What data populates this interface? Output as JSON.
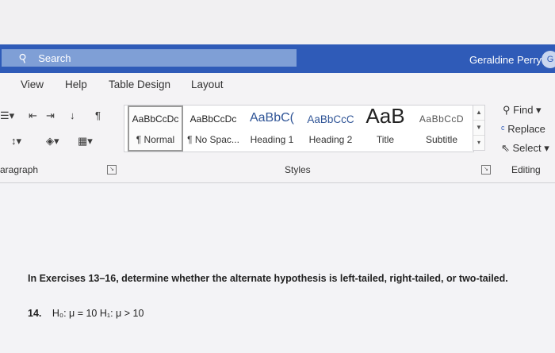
{
  "titlebar": {
    "search_label": "Search",
    "user_name": "Geraldine Perry",
    "avatar_initial": "G"
  },
  "tabs": [
    "View",
    "Help",
    "Table Design",
    "Layout"
  ],
  "styles": [
    {
      "sample": "AaBbCcDc",
      "name": "¶ Normal"
    },
    {
      "sample": "AaBbCcDc",
      "name": "¶ No Spac..."
    },
    {
      "sample": "AaBbC(",
      "name": "Heading 1"
    },
    {
      "sample": "AaBbCcC",
      "name": "Heading 2"
    },
    {
      "sample": "AaB",
      "name": "Title"
    },
    {
      "sample": "AaBbCcD",
      "name": "Subtitle"
    }
  ],
  "editing": {
    "find": "Find",
    "replace": "Replace",
    "select": "Select"
  },
  "group_labels": {
    "paragraph": "aragraph",
    "styles": "Styles",
    "editing": "Editing"
  },
  "document": {
    "question": "In Exercises 13–16, determine whether the alternate hypothesis is left-tailed, right-tailed, or two-tailed.",
    "item_number": "14.",
    "item_text": "H₀: μ = 10   H₁: μ > 10"
  },
  "colors": {
    "titlebar": "#2f5bb8",
    "searchbox": "#7f9fd6"
  }
}
